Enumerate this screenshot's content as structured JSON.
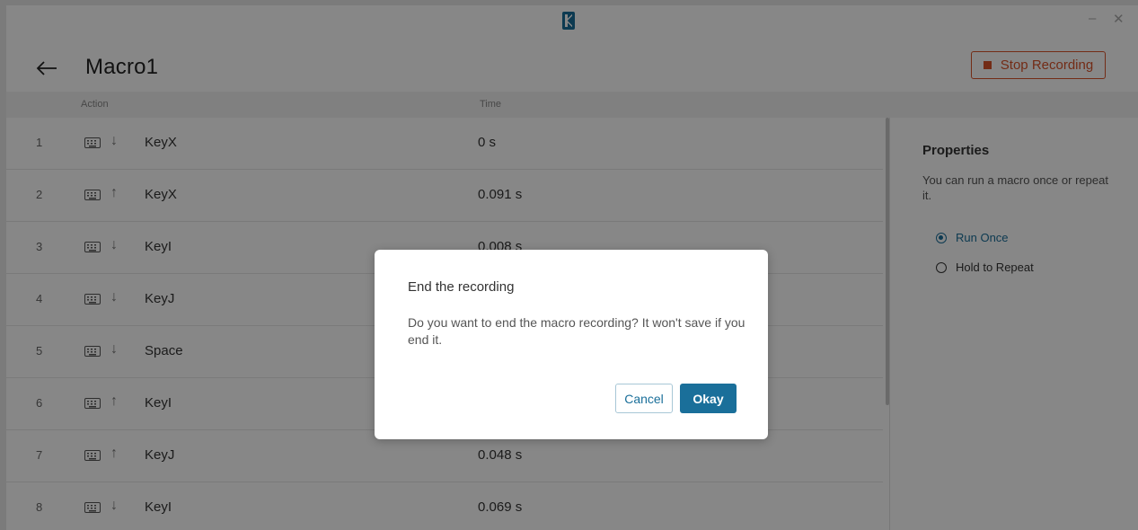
{
  "titlebar": {
    "minimize_glyph": "–",
    "close_glyph": "✕"
  },
  "header": {
    "title": "Macro1",
    "stop_label": "Stop Recording"
  },
  "table": {
    "columns": [
      "Action",
      "Time"
    ],
    "rows": [
      {
        "num": "1",
        "device_icon": "keyboard-icon",
        "direction": "↓",
        "direction_icon": "key-down-icon",
        "key": "KeyX",
        "time": "0 s"
      },
      {
        "num": "2",
        "device_icon": "keyboard-icon",
        "direction": "↑",
        "direction_icon": "key-up-icon",
        "key": "KeyX",
        "time": "0.091 s"
      },
      {
        "num": "3",
        "device_icon": "keyboard-icon",
        "direction": "↓",
        "direction_icon": "key-down-icon",
        "key": "KeyI",
        "time": "0.008 s"
      },
      {
        "num": "4",
        "device_icon": "keyboard-icon",
        "direction": "↓",
        "direction_icon": "key-down-icon",
        "key": "KeyJ",
        "time": ""
      },
      {
        "num": "5",
        "device_icon": "keyboard-icon",
        "direction": "↓",
        "direction_icon": "key-down-icon",
        "key": "Space",
        "time": ""
      },
      {
        "num": "6",
        "device_icon": "keyboard-icon",
        "direction": "↑",
        "direction_icon": "key-up-icon",
        "key": "KeyI",
        "time": ""
      },
      {
        "num": "7",
        "device_icon": "keyboard-icon",
        "direction": "↑",
        "direction_icon": "key-up-icon",
        "key": "KeyJ",
        "time": "0.048 s"
      },
      {
        "num": "8",
        "device_icon": "keyboard-icon",
        "direction": "↓",
        "direction_icon": "key-down-icon",
        "key": "KeyI",
        "time": "0.069 s"
      }
    ]
  },
  "properties": {
    "title": "Properties",
    "description": "You can run a macro once or repeat it.",
    "options": [
      {
        "label": "Run Once",
        "selected": true
      },
      {
        "label": "Hold to Repeat",
        "selected": false
      }
    ]
  },
  "dialog": {
    "title": "End the recording",
    "message": "Do you want to end the macro recording? It won't save if you end it.",
    "cancel_label": "Cancel",
    "okay_label": "Okay"
  },
  "colors": {
    "accent": "#1a6f9a",
    "stop": "#d9532b"
  }
}
